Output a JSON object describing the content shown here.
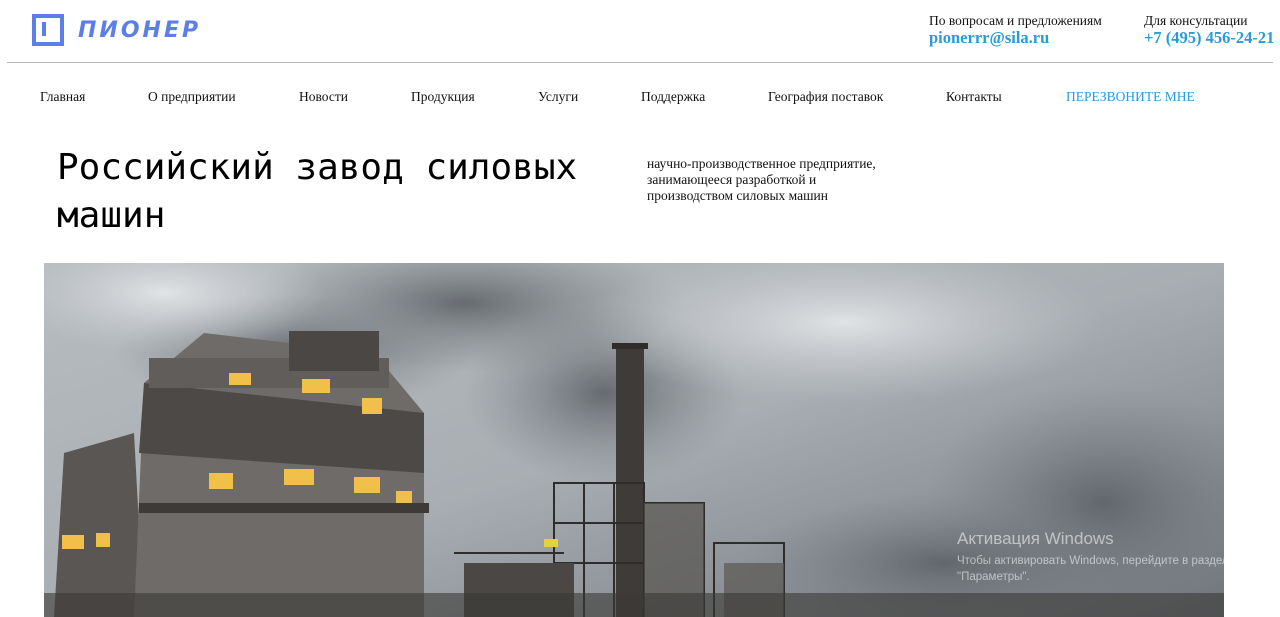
{
  "brand": {
    "name": "ПИОНЕР",
    "logo_icon": "square-bracket-logo-icon",
    "color": "#5b7fe6"
  },
  "contacts": {
    "email": {
      "label": "По вопросам и предложениям",
      "value": "pionerrr@sila.ru"
    },
    "phone": {
      "label": "Для консультации",
      "value": "+7 (495) 456-24-21"
    },
    "accent_color": "#2a9bd8"
  },
  "nav": {
    "items": [
      {
        "label": "Главная"
      },
      {
        "label": "О предприятии"
      },
      {
        "label": "Новости"
      },
      {
        "label": "Продукция"
      },
      {
        "label": "Услуги"
      },
      {
        "label": "Поддержка"
      },
      {
        "label": "География поставок"
      },
      {
        "label": "Контакты"
      }
    ],
    "cta": "ПЕРЕЗВОНИТЕ МНЕ"
  },
  "hero": {
    "title": "Российский завод силовых машин",
    "description": "научно-производственное предприятие, занимающееся разработкой и производством силовых машин",
    "image": "industrial-plant-photo"
  },
  "watermark": {
    "title": "Активация Windows",
    "text": "Чтобы активировать Windows, перейдите в раздел \"Параметры\"."
  }
}
